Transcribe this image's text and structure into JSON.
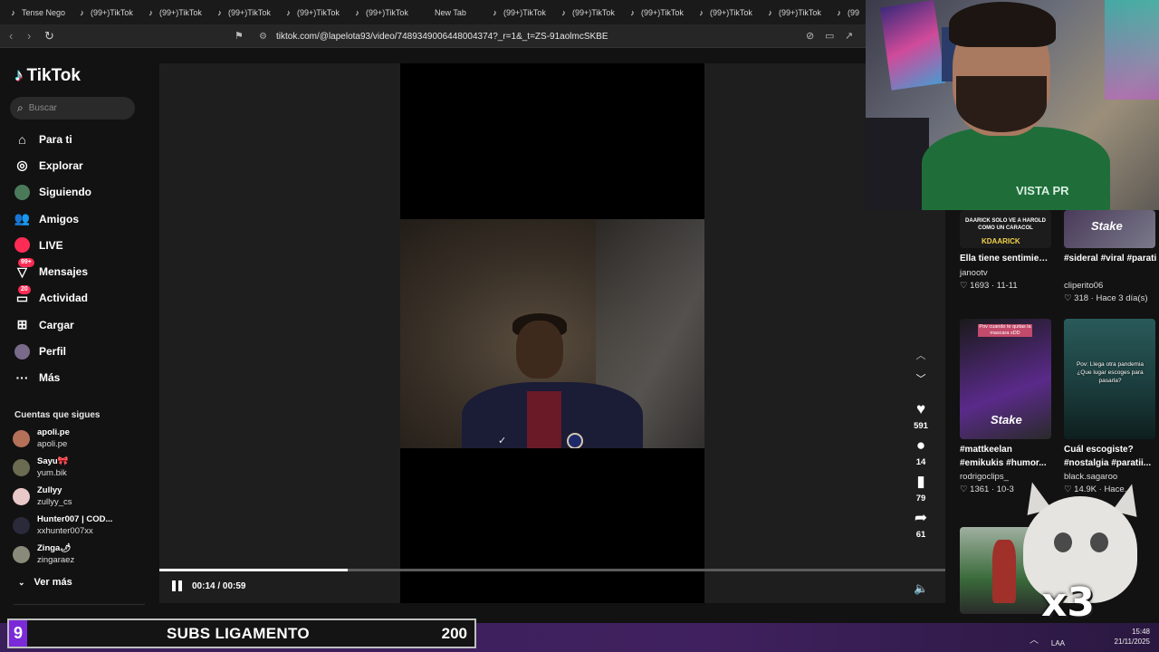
{
  "browser": {
    "tabs": [
      {
        "label": "Tense Nego"
      },
      {
        "label": "(99+)TikTok"
      },
      {
        "label": "(99+)TikTok"
      },
      {
        "label": "(99+)TikTok"
      },
      {
        "label": "(99+)TikTok"
      },
      {
        "label": "(99+)TikTok"
      },
      {
        "label": "New Tab"
      },
      {
        "label": "(99+)TikTok"
      },
      {
        "label": "(99+)TikTok"
      },
      {
        "label": "(99+)TikTok"
      },
      {
        "label": "(99+)TikTok"
      },
      {
        "label": "(99+)TikTok"
      },
      {
        "label": "(99"
      }
    ],
    "url": "tiktok.com/@lapelota93/video/7489349006448004374?_r=1&_t=ZS-91aolmcSKBE"
  },
  "sidebar": {
    "brand": "TikTok",
    "search_placeholder": "Buscar",
    "items": [
      {
        "label": "Para ti",
        "icon": "home-icon"
      },
      {
        "label": "Explorar",
        "icon": "compass-icon"
      },
      {
        "label": "Siguiendo",
        "icon": "avatar-icon"
      },
      {
        "label": "Amigos",
        "icon": "friends-icon"
      },
      {
        "label": "LIVE",
        "icon": "live-icon"
      },
      {
        "label": "Mensajes",
        "icon": "messages-icon",
        "badge": "99+"
      },
      {
        "label": "Actividad",
        "icon": "activity-icon",
        "badge": "20"
      },
      {
        "label": "Cargar",
        "icon": "upload-icon"
      },
      {
        "label": "Perfil",
        "icon": "profile-avatar-icon"
      },
      {
        "label": "Más",
        "icon": "more-dots-icon"
      }
    ],
    "following_title": "Cuentas que sigues",
    "following": [
      {
        "name": "apoli.pe",
        "handle": "apoli.pe",
        "color": "#b5705a"
      },
      {
        "name": "Sayu🎀",
        "handle": "yum.bik",
        "color": "#6b6b52"
      },
      {
        "name": "Zullyy",
        "handle": "zullyy_cs",
        "color": "#e8c8c8"
      },
      {
        "name": "Hunter007 | COD...",
        "handle": "xxhunter007xx",
        "color": "#2a2a3a"
      },
      {
        "name": "Zinga🌶",
        "handle": "zingaraez",
        "color": "#8a8a7a"
      }
    ],
    "see_more": "Ver más"
  },
  "player": {
    "time": "00:14 / 00:59",
    "progress": 0.24,
    "actions": [
      {
        "icon": "heart-icon",
        "count": "591"
      },
      {
        "icon": "comment-icon",
        "count": "14"
      },
      {
        "icon": "bookmark-icon",
        "count": "79"
      },
      {
        "icon": "share-icon",
        "count": "61"
      }
    ]
  },
  "recommended": [
    {
      "title": "Ella tiene sentimientos...",
      "user": "janootv",
      "likes": "1693",
      "date": "11-11",
      "thumb_text": "DAARICK SOLO VE A HAROLD COMO UN CARACOL",
      "thumb_brand": "KDAARICK"
    },
    {
      "title": "#sideral #viral #parati",
      "user": "cliperito06",
      "likes": "318",
      "date": "Hace 3 día(s)",
      "thumb_brand": "Stake"
    },
    {
      "title": "#mattkeelan #emikukis #humor...",
      "user": "rodrigoclips_",
      "likes": "1361",
      "date": "10-3",
      "thumb_text": "Pov cuando te quitas la mascara xDD",
      "thumb_brand": "Stake"
    },
    {
      "title": "Cuál escogiste? #nostalgia #paratii...",
      "user": "black.sagaroo",
      "likes": "14.9K",
      "date": "Hace...",
      "thumb_text": "Pov: Llega otra pandemia ¿Que lugar escoges para pasarla?"
    }
  ],
  "overlay": {
    "subs_badge": "9",
    "subs_label": "SUBS LIGAMENTO",
    "subs_value": "200",
    "cat_text": "x3",
    "jersey_text": "VISTA PR"
  },
  "taskbar": {
    "lang": "LAA",
    "time": "15:48",
    "date": "21/11/2025"
  }
}
